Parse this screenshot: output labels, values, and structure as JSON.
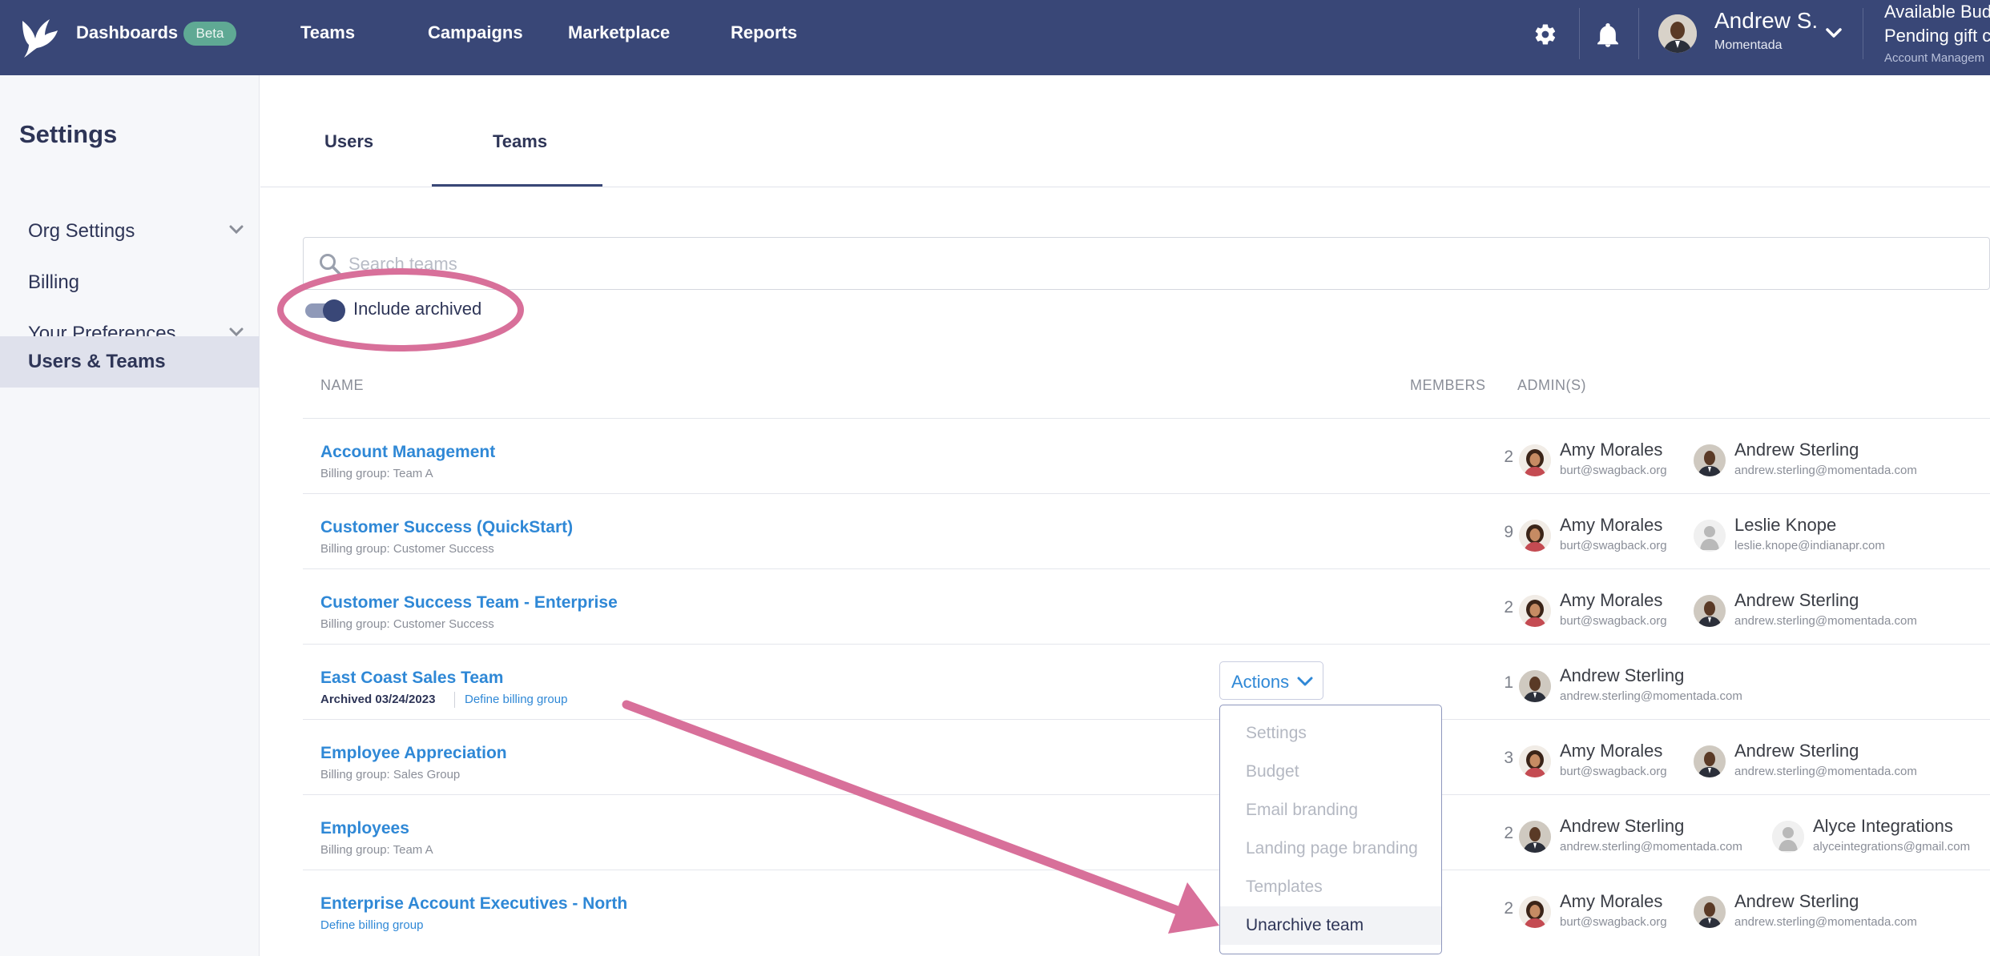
{
  "topbar": {
    "nav": [
      {
        "label": "Dashboards"
      },
      {
        "label": "Teams"
      },
      {
        "label": "Campaigns"
      },
      {
        "label": "Marketplace"
      },
      {
        "label": "Reports"
      }
    ],
    "beta_badge": "Beta",
    "user": {
      "name": "Andrew S.",
      "org": "Momentada"
    },
    "budget_lines": [
      "Available Budge",
      "Pending gift co"
    ],
    "account_sub": "Account Managem",
    "icons": [
      "logo-bird-icon",
      "gear-icon",
      "bell-icon",
      "chevron-down-icon"
    ]
  },
  "sidebar": {
    "title": "Settings",
    "items": [
      {
        "label": "Org Settings",
        "expandable": true
      },
      {
        "label": "Billing",
        "expandable": false
      },
      {
        "label": "Your Preferences",
        "expandable": true
      },
      {
        "label": "Users & Teams",
        "active": true
      }
    ]
  },
  "tabs": [
    {
      "label": "Users"
    },
    {
      "label": "Teams",
      "active": true
    }
  ],
  "search": {
    "placeholder": "Search teams",
    "value": ""
  },
  "toggle": {
    "label": "Include archived",
    "on": true
  },
  "table": {
    "headers": {
      "name": "NAME",
      "members": "MEMBERS",
      "admins": "ADMIN(S)"
    },
    "rows": [
      {
        "name": "Account Management",
        "billing": "Billing group: Team A",
        "members": "2",
        "admins": [
          {
            "name": "Amy Morales",
            "email": "burt@swagback.org"
          },
          {
            "name": "Andrew Sterling",
            "email": "andrew.sterling@momentada.com"
          }
        ]
      },
      {
        "name": "Customer Success (QuickStart)",
        "billing": "Billing group: Customer Success",
        "members": "9",
        "admins": [
          {
            "name": "Amy Morales",
            "email": "burt@swagback.org"
          },
          {
            "name": "Leslie Knope",
            "email": "leslie.knope@indianapr.com"
          }
        ]
      },
      {
        "name": "Customer Success Team - Enterprise",
        "billing": "Billing group: Customer Success",
        "members": "2",
        "admins": [
          {
            "name": "Amy Morales",
            "email": "burt@swagback.org"
          },
          {
            "name": "Andrew Sterling",
            "email": "andrew.sterling@momentada.com"
          }
        ]
      },
      {
        "name": "East Coast Sales Team",
        "archived": "Archived 03/24/2023",
        "billing_link": "Define billing group",
        "members": "1",
        "admins": [
          {
            "name": "Andrew Sterling",
            "email": "andrew.sterling@momentada.com"
          }
        ]
      },
      {
        "name": "Employee Appreciation",
        "billing": "Billing group: Sales Group",
        "members": "3",
        "admins": [
          {
            "name": "Amy Morales",
            "email": "burt@swagback.org"
          },
          {
            "name": "Andrew Sterling",
            "email": "andrew.sterling@momentada.com"
          }
        ]
      },
      {
        "name": "Employees",
        "billing": "Billing group: Team A",
        "members": "2",
        "admins": [
          {
            "name": "Andrew Sterling",
            "email": "andrew.sterling@momentada.com"
          },
          {
            "name": "Alyce Integrations",
            "email": "alyceintegrations@gmail.com"
          }
        ]
      },
      {
        "name": "Enterprise Account Executives - North",
        "billing_link": "Define billing group",
        "members": "2",
        "admins": [
          {
            "name": "Amy Morales",
            "email": "burt@swagback.org"
          },
          {
            "name": "Andrew Sterling",
            "email": "andrew.sterling@momentada.com"
          }
        ]
      }
    ]
  },
  "actions": {
    "label": "Actions",
    "menu": [
      {
        "label": "Settings",
        "enabled": false
      },
      {
        "label": "Budget",
        "enabled": false
      },
      {
        "label": "Email branding",
        "enabled": false
      },
      {
        "label": "Landing page branding",
        "enabled": false
      },
      {
        "label": "Templates",
        "enabled": false
      },
      {
        "label": "Unarchive team",
        "enabled": true
      }
    ]
  },
  "colors": {
    "topbar": "#394777",
    "link": "#2f88d6",
    "annotation": "#d8709a",
    "beta": "#5fa994"
  }
}
